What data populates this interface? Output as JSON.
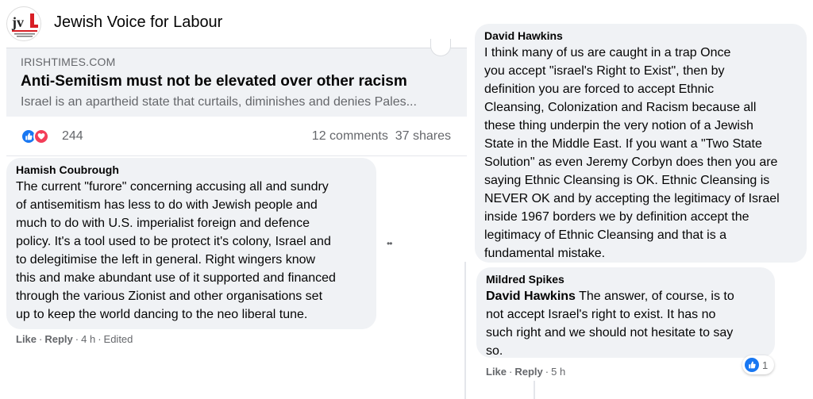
{
  "post": {
    "group_name": "Jewish Voice for Labour",
    "logo": {
      "text": "jvl",
      "subtext": "JEWISH VOICE FOR LABOUR"
    },
    "link": {
      "domain": "IRISHTIMES.COM",
      "title": "Anti-Semitism must not be elevated over other racism",
      "description": "Israel is an apartheid state that curtails, diminishes and denies Pales..."
    },
    "reactions": {
      "icons": [
        "like-icon",
        "love-icon"
      ],
      "count": "244",
      "comments": "12 comments",
      "shares": "37 shares"
    }
  },
  "comments": [
    {
      "author": "Hamish Coubrough",
      "lines": [
        "The current \"furore\" concerning accusing all and sundry",
        "of antisemitism has less to do with Jewish people and",
        "much to do with U.S. imperialist foreign and defence",
        "policy. It's a tool used to be protect it's colony, Israel and",
        "to delegitimise the left in general. Right wingers know",
        "this and make abundant use of it supported and financed",
        "through the various Zionist and other organisations set",
        "up to keep the world dancing to the neo liberal tune."
      ],
      "actions": {
        "like": "Like",
        "reply": "Reply",
        "time": "4 h",
        "edited": "Edited"
      },
      "more": "••"
    },
    {
      "author": "David Hawkins",
      "lines": [
        "I think many of us are caught in a trap  Once",
        "you accept \"israel's Right to Exist\", then by",
        "definition you are forced to accept Ethnic",
        "Cleansing, Colonization and Racism because all",
        "these thing underpin the very notion of a Jewish",
        "State in the Middle East. If you want a \"Two State",
        "Solution\" as even Jeremy Corbyn does then you are",
        "saying Ethnic Cleansing is OK. Ethnic Cleansing is",
        "NEVER OK and by accepting the legitimacy of Israel",
        "inside 1967 borders we by definition accept the",
        "legitimacy of Ethnic Cleansing and that is a",
        "fundamental mistake."
      ]
    },
    {
      "author": "Mildred Spikes",
      "mention": "David Hawkins",
      "first_line_rest": " The answer, of course, is to",
      "lines": [
        "not accept Israel's right to exist. It has no",
        "such right and we should not hesitate to say",
        "so."
      ],
      "actions": {
        "like": "Like",
        "reply": "Reply",
        "time": "5 h"
      },
      "reaction": {
        "icon": "like-icon",
        "count": "1"
      }
    }
  ],
  "colors": {
    "bubble": "#f0f2f5",
    "meta_text": "#65676b",
    "like_blue": "#1877f2",
    "love_red": "#f33e58",
    "logo_red": "#d81f26"
  }
}
